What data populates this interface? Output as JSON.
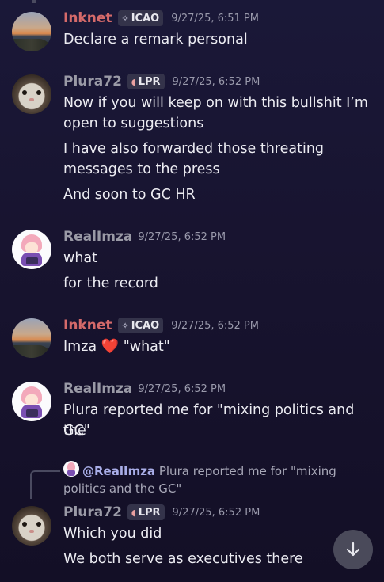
{
  "messages": [
    {
      "username": "Inknet",
      "tag": "ICAO",
      "tag_icon": "diamond-sparkle-icon",
      "timestamp": "9/27/25, 6:51 PM",
      "lines": [
        "Declare a remark personal"
      ]
    },
    {
      "username": "Plura72",
      "tag": "LPR",
      "tag_icon": "ham-icon",
      "timestamp": "9/27/25, 6:52 PM",
      "lines": [
        "Now if you will keep on with this bullshit I’m",
        "open to suggestions",
        "I have also forwarded those threating",
        "messages to the press",
        "And soon to GC HR"
      ]
    },
    {
      "username": "RealImza",
      "timestamp": "9/27/25, 6:52 PM",
      "lines": [
        "what",
        "for the record"
      ]
    },
    {
      "username": "Inknet",
      "tag": "ICAO",
      "tag_icon": "diamond-sparkle-icon",
      "timestamp": "9/27/25, 6:52 PM",
      "line_pre": "Imza",
      "line_emoji": "❤️",
      "line_post": "\"what\""
    },
    {
      "username": "RealImza",
      "timestamp": "9/27/25, 6:52 PM",
      "lines": [
        "Plura reported me for \"mixing politics and the",
        "GC\""
      ]
    },
    {
      "reply": {
        "mention": "@RealImza",
        "text_line1": "Plura reported me for \"mixing",
        "text_line2": "politics and the GC\""
      },
      "username": "Plura72",
      "tag": "LPR",
      "tag_icon": "ham-icon",
      "timestamp": "9/27/25, 6:52 PM",
      "lines": [
        "Which you did",
        "We both serve as executives there"
      ]
    }
  ],
  "colors": {
    "background": "#1a1838",
    "username_red": "#d56a6a",
    "username_grey": "#9a9aa6",
    "tag_bg": "#34334a",
    "scroll_button": "#4a4a5a"
  },
  "scroll_button_icon": "arrow-down-icon"
}
